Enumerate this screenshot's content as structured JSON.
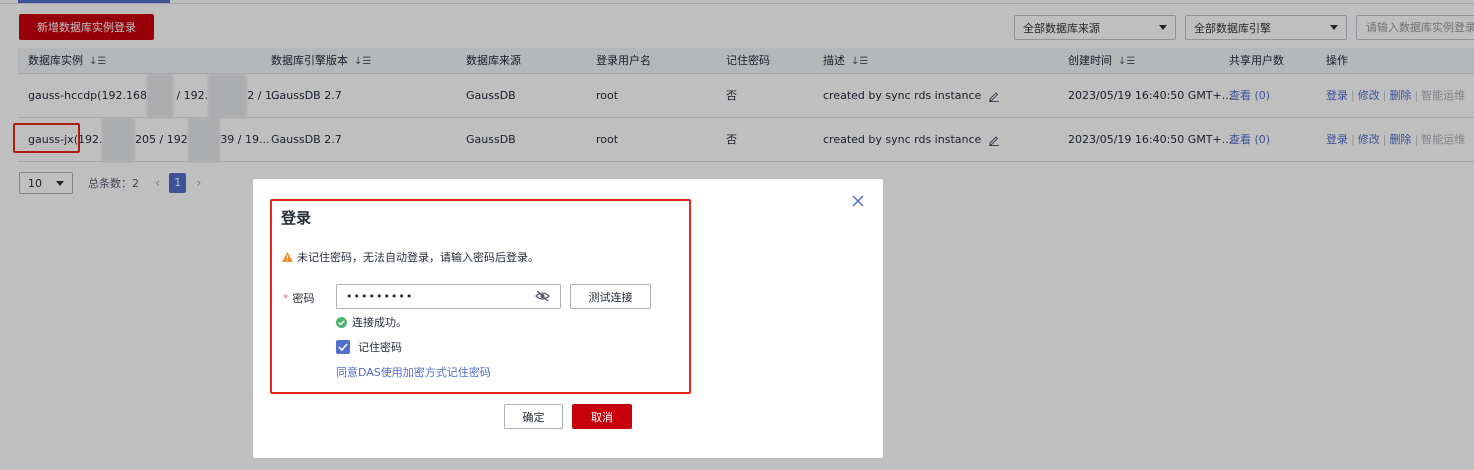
{
  "toolbar": {
    "new_button": "新增数据库实例登录",
    "source_filter": "全部数据库来源",
    "engine_filter": "全部数据库引擎",
    "search_placeholder": "请输入数据库实例登录"
  },
  "table": {
    "headers": [
      "数据库实例",
      "数据库引擎版本",
      "数据库来源",
      "登录用户名",
      "记住密码",
      "描述",
      "创建时间",
      "共享用户数",
      "操作"
    ],
    "rows": [
      {
        "instance_prefix": "gauss-hccdp(192.168",
        "instance_mid": "/ 192.",
        "instance_tail": "2 / 1...",
        "engine": "GaussDB 2.7",
        "source": "GaussDB",
        "user": "root",
        "remember": "否",
        "desc": "created by sync rds instance",
        "created": "2023/05/19 16:40:50 GMT+...",
        "shared": "查看 (0)"
      },
      {
        "instance_prefix": "gauss-jx(192.",
        "instance_mid": "205 / 192",
        "instance_tail": "39 / 19...",
        "engine": "GaussDB 2.7",
        "source": "GaussDB",
        "user": "root",
        "remember": "否",
        "desc": "created by sync rds instance",
        "created": "2023/05/19 16:40:50 GMT+...",
        "shared": "查看 (0)"
      }
    ],
    "ops": [
      "登录",
      "修改",
      "删除",
      "智能运维"
    ]
  },
  "pager": {
    "page_size": "10",
    "total": "总条数：2",
    "current": "1"
  },
  "dialog": {
    "title": "登录",
    "warning": "未记住密码，无法自动登录，请输入密码后登录。",
    "password_label": "密码",
    "password_value": "•••••••••",
    "test_button": "测试连接",
    "success_msg": "连接成功。",
    "remember_label": "记住密码",
    "agree_link": "同意DAS使用加密方式记住密码",
    "ok_button": "确定",
    "cancel_button": "取消"
  },
  "colors": {
    "brand_red": "#c7000b",
    "link_blue": "#526ecc",
    "highlight_red": "#e8271b"
  }
}
